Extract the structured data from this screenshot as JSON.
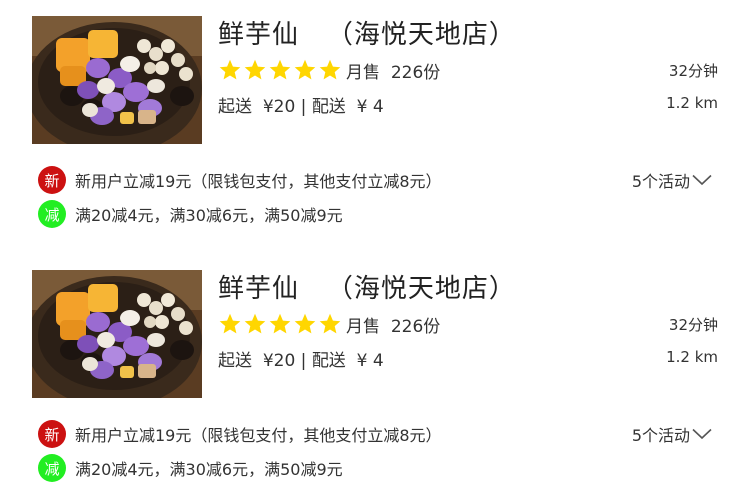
{
  "icons": {
    "star": "star-icon",
    "chevron": "chevron-down-icon",
    "food": "food-photo"
  },
  "colors": {
    "star": "#ffd600",
    "badge_new": "#cc1111",
    "badge_discount": "#22ee22"
  },
  "listings": [
    {
      "name": "鲜芋仙",
      "branch": "（海悦天地店）",
      "rating": 5,
      "rating_max": 5,
      "sales_label": "月售",
      "sales_value": "226份",
      "delivery_time": "32分钟",
      "min_order_label": "起送",
      "min_order_value": "¥20",
      "separator": "|",
      "delivery_fee_label": "配送",
      "delivery_fee_value": "¥ 4",
      "distance": "1.2 km",
      "promo_new_badge": "新",
      "promo_new_text": "新用户立减19元（限钱包支付，其他支付立减8元）",
      "promo_discount_badge": "减",
      "promo_discount_text": "满20减4元，满30减6元，满50减9元",
      "activities_label": "5个活动"
    },
    {
      "name": "鲜芋仙",
      "branch": "（海悦天地店）",
      "rating": 5,
      "rating_max": 5,
      "sales_label": "月售",
      "sales_value": "226份",
      "delivery_time": "32分钟",
      "min_order_label": "起送",
      "min_order_value": "¥20",
      "separator": "|",
      "delivery_fee_label": "配送",
      "delivery_fee_value": "¥ 4",
      "distance": "1.2 km",
      "promo_new_badge": "新",
      "promo_new_text": "新用户立减19元（限钱包支付，其他支付立减8元）",
      "promo_discount_badge": "减",
      "promo_discount_text": "满20减4元，满30减6元，满50减9元",
      "activities_label": "5个活动"
    }
  ]
}
